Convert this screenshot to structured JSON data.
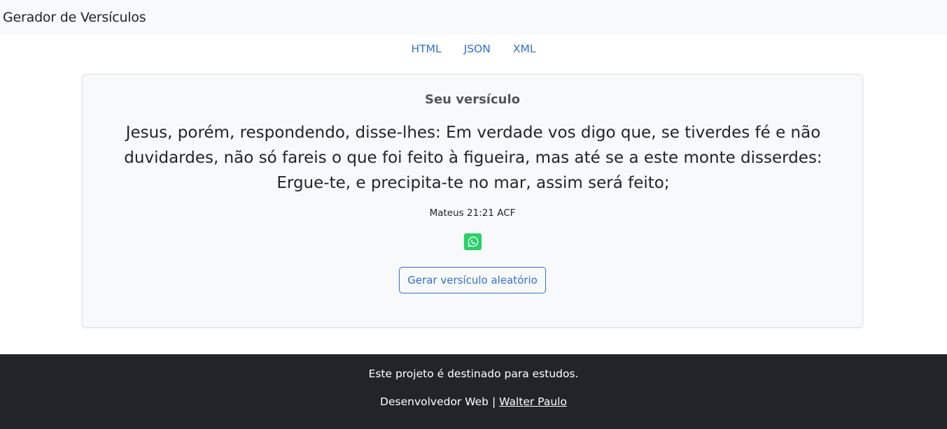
{
  "navbar": {
    "brand": "Gerador de Versículos"
  },
  "formats": [
    {
      "label": "HTML"
    },
    {
      "label": "JSON"
    },
    {
      "label": "XML"
    }
  ],
  "card": {
    "title": "Seu versículo",
    "verse": "Jesus, porém, respondendo, disse-lhes: Em verdade vos digo que, se tiverdes fé e não duvidardes, não só fareis o que foi feito à figueira, mas até se a este monte disserdes: Ergue-te, e precipita-te no mar, assim será feito;",
    "reference": "Mateus 21:21 ACF",
    "share_icon": "whatsapp-icon",
    "button_label": "Gerar versículo aleatório"
  },
  "footer": {
    "line1": "Este projeto é destinado para estudos.",
    "line2_prefix": "Desenvolvedor Web |",
    "author_link": "Walter Paulo"
  },
  "colors": {
    "link": "#2f6fdc",
    "navbar_bg": "#f8f9fa",
    "footer_bg": "#212529",
    "whatsapp": "#25d366"
  }
}
